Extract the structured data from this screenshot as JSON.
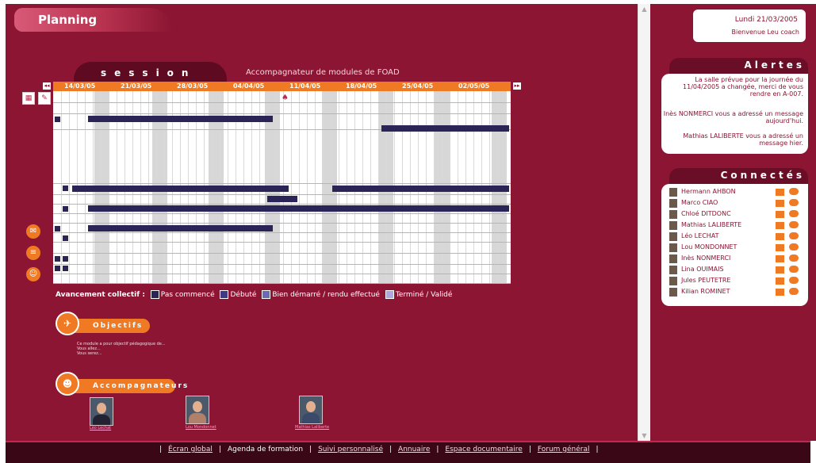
{
  "header": {
    "title": "Planning"
  },
  "session": {
    "label": "session",
    "subtitle": "Accompagnateur de modules de FOAD"
  },
  "dates": [
    "14/03/05",
    "21/03/05",
    "28/03/05",
    "04/04/05",
    "11/04/05",
    "18/04/05",
    "25/04/05",
    "02/05/05"
  ],
  "legend": {
    "label": "Avancement collectif :",
    "items": [
      {
        "label": "Pas commencé",
        "color": "#2b2457"
      },
      {
        "label": "Débuté",
        "color": "#3e3a86"
      },
      {
        "label": "Bien démarré / rendu effectué",
        "color": "#6c6ab8"
      },
      {
        "label": "Terminé / Validé",
        "color": "#b1a6df"
      }
    ]
  },
  "objectifs": {
    "title": "Objectifs",
    "lines": [
      "Ce module a pour objectif pédagogique de...",
      "Vous allez...",
      "Vous serez..."
    ]
  },
  "accompagnateurs": {
    "title": "Accompagnateurs",
    "people": [
      "Léo Lechat",
      "Lou Mondonnet",
      "Mathias Laliberte"
    ]
  },
  "datebox": {
    "date": "Lundi 21/03/2005",
    "welcome": "Bienvenue Leu coach"
  },
  "alertes": {
    "title": "Alertes",
    "messages": [
      "La salle prévue pour la journée du 11/04/2005 a changée, merci de vous rendre en A-007.",
      "Inès NONMERCI vous a adressé un message aujourd'hui.",
      "Mathias LALIBERTE vous a adressé un message hier."
    ]
  },
  "connectes": {
    "title": "Connectés",
    "users": [
      "Hermann AHBON",
      "Marco CIAO",
      "Chloé DITDONC",
      "Mathias LALIBERTE",
      "Léo LECHAT",
      "Lou MONDONNET",
      "Inès NONMERCI",
      "Lina OUIMAIS",
      "Jules PEUTETRE",
      "Kilian ROMINET"
    ]
  },
  "nav": {
    "items": [
      "Écran global",
      "Agenda de formation",
      "Suivi personnalisé",
      "Annuaire",
      "Espace documentaire",
      "Forum général"
    ],
    "active": "Agenda de formation"
  }
}
